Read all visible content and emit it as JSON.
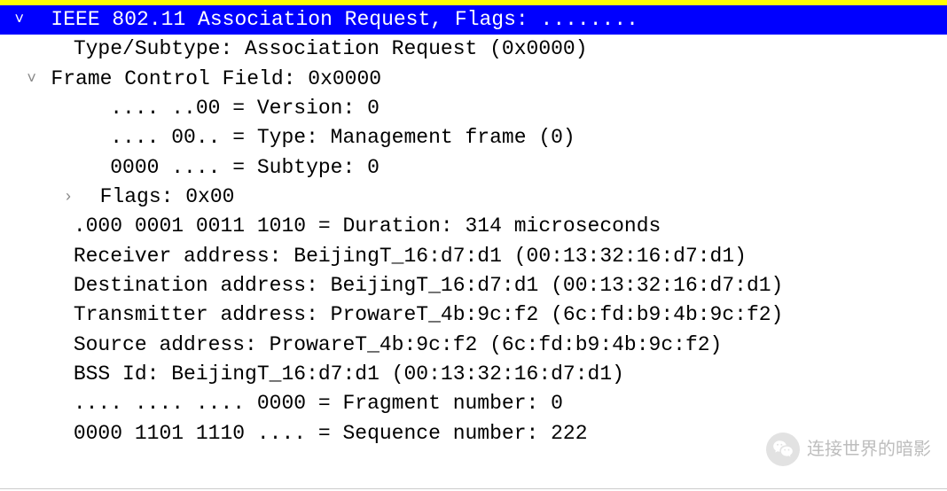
{
  "header": {
    "chevron": "˅",
    "title": "IEEE 802.11 Association Request, Flags: ........"
  },
  "lines": {
    "type_subtype": "Type/Subtype: Association Request (0x0000)",
    "fcf_chevron": "˅",
    "fcf": "Frame Control Field: 0x0000",
    "version": ".... ..00 = Version: 0",
    "type": ".... 00.. = Type: Management frame (0)",
    "subtype": "0000 .... = Subtype: 0",
    "flags_chevron": "›",
    "flags": "Flags: 0x00",
    "duration": ".000 0001 0011 1010 = Duration: 314 microseconds",
    "receiver": "Receiver address: BeijingT_16:d7:d1 (00:13:32:16:d7:d1)",
    "destination": "Destination address: BeijingT_16:d7:d1 (00:13:32:16:d7:d1)",
    "transmitter": "Transmitter address: ProwareT_4b:9c:f2 (6c:fd:b9:4b:9c:f2)",
    "source": "Source address: ProwareT_4b:9c:f2 (6c:fd:b9:4b:9c:f2)",
    "bssid": "BSS Id: BeijingT_16:d7:d1 (00:13:32:16:d7:d1)",
    "fragment": ".... .... .... 0000 = Fragment number: 0",
    "sequence": "0000 1101 1110 .... = Sequence number: 222"
  },
  "watermark": {
    "text": "连接世界的暗影"
  }
}
